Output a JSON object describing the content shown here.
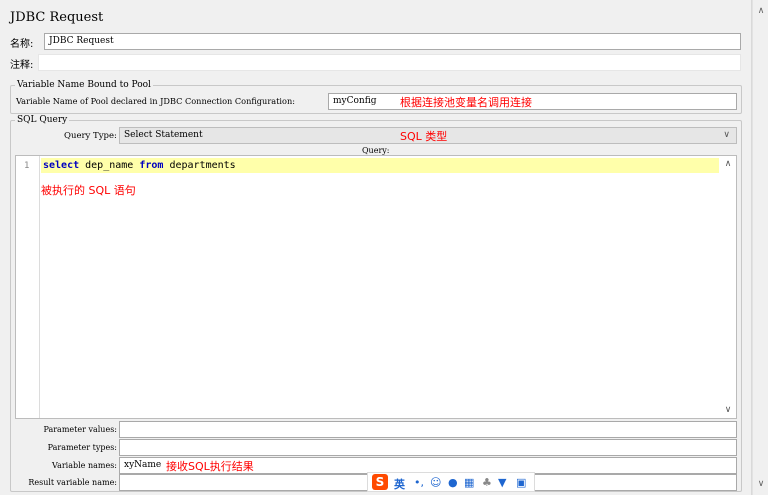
{
  "title": "JDBC Request",
  "name": {
    "label": "名称:",
    "value": "JDBC Request"
  },
  "comments": {
    "label": "注释:",
    "value": ""
  },
  "pool_group": {
    "legend": "Variable Name Bound to Pool",
    "label": "Variable Name of Pool declared in JDBC Connection Configuration:",
    "value": "myConfig",
    "note": "根据连接池变量名调用连接"
  },
  "sql_group": {
    "legend": "SQL Query",
    "query_type_label": "Query Type:",
    "query_type_value": "Select Statement",
    "query_type_note": "SQL 类型",
    "query_label": "Query:",
    "line_number": "1",
    "code": {
      "kw1": "select",
      "t1": " dep_name ",
      "kw2": "from",
      "t2": " departments"
    },
    "code_note": "被执行的 SQL 语句"
  },
  "params": {
    "parameter_values": {
      "label": "Parameter values:",
      "value": ""
    },
    "parameter_types": {
      "label": "Parameter types:",
      "value": ""
    },
    "variable_names": {
      "label": "Variable names:",
      "value": "xyName",
      "note": "接收SQL执行结果"
    },
    "result_variable_name": {
      "label": "Result variable name:",
      "value": ""
    }
  },
  "ime": {
    "logo": "S",
    "lang": "英"
  },
  "colors": {
    "note": "#ff0000",
    "highlight": "#ffffaa",
    "keyword": "#0000c0"
  }
}
